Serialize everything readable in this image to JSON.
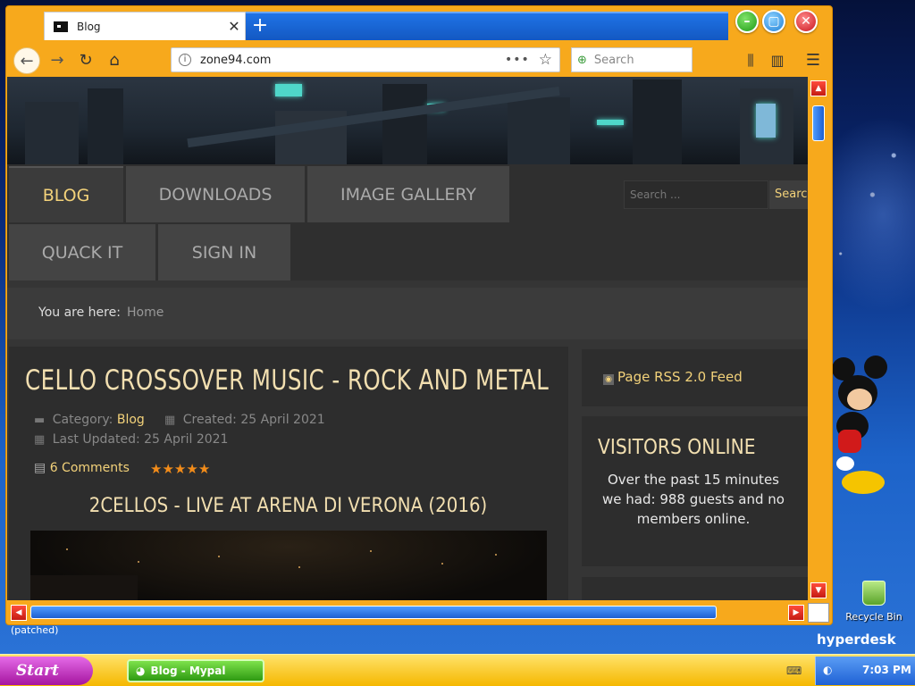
{
  "browser": {
    "tab_title": "Blog",
    "tab_close": "✕",
    "new_tab": "+",
    "url": "zone94.com",
    "url_more": "•••",
    "search_placeholder": "Search",
    "window_buttons": {
      "minimize": "–",
      "maximize": "▢",
      "close": "✕"
    }
  },
  "site": {
    "menu": {
      "blog": "BLOG",
      "downloads": "DOWNLOADS",
      "image_gallery": "IMAGE GALLERY",
      "quack_it": "QUACK IT",
      "sign_in": "SIGN IN"
    },
    "search_placeholder": "Search ...",
    "search_button": "Searc",
    "breadcrumb": {
      "label": "You are here:",
      "home": "Home"
    },
    "article": {
      "title": "CELLO CROSSOVER MUSIC - ROCK AND METAL",
      "category_label": "Category:",
      "category": "Blog",
      "created": "Created: 25 April 2021",
      "updated": "Last Updated: 25 April 2021",
      "comments": "6 Comments",
      "rating_stars": 5,
      "video_title": "2CELLOS - LIVE AT ARENA DI VERONA (2016)"
    },
    "sidebar": {
      "rss": "Page RSS 2.0 Feed",
      "visitors_title": "VISITORS ONLINE",
      "visitors_text": "Over the past 15 minutes we had: 988 guests and no members online."
    }
  },
  "desktop": {
    "patched_label": "(patched)",
    "recycle_bin": "Recycle Bin",
    "brand": "hyperdesk"
  },
  "taskbar": {
    "start": "Start",
    "task_item": "Blog - Mypal",
    "clock": "7:03 PM"
  }
}
